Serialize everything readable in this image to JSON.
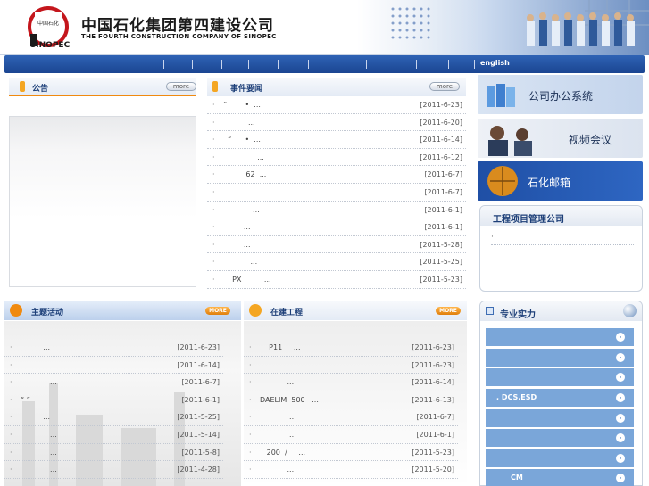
{
  "header": {
    "company_cn": "中国石化集团第四建设公司",
    "company_en": "THE FOURTH CONSTRUCTION COMPANY OF SINOPEC",
    "logo_text": "SINOPEC"
  },
  "nav": {
    "english_label": "english"
  },
  "announce": {
    "title": "公告",
    "more": "more"
  },
  "events": {
    "title": "事件要闻",
    "more": "more",
    "items": [
      {
        "text": "“        •  ...",
        "date": "[2011-6-23]"
      },
      {
        "text": "           ...",
        "date": "[2011-6-20]"
      },
      {
        "text": "  “      •  ...",
        "date": "[2011-6-14]"
      },
      {
        "text": "               ...",
        "date": "[2011-6-12]"
      },
      {
        "text": "          62  ...",
        "date": "[2011-6-7]"
      },
      {
        "text": "             ...",
        "date": "[2011-6-7]"
      },
      {
        "text": "             ...",
        "date": "[2011-6-1]"
      },
      {
        "text": "         ...",
        "date": "[2011-6-1]"
      },
      {
        "text": "         ...",
        "date": "[2011-5-28]"
      },
      {
        "text": "            ...",
        "date": "[2011-5-25]"
      },
      {
        "text": "    PX          ...",
        "date": "[2011-5-23]"
      }
    ]
  },
  "side": {
    "office": "公司办公系统",
    "video": "视频会议",
    "mail": "石化邮箱",
    "project_company_title": "工程项目管理公司",
    "project_company_item": "·",
    "strength_title": "专业实力",
    "strength_items": [
      "",
      "",
      "",
      ", DCS,ESD",
      "",
      "",
      "",
      "CM"
    ]
  },
  "topic": {
    "title": "主题活动",
    "more": "MORE",
    "items": [
      {
        "text": "          ...",
        "date": "[2011-6-23]"
      },
      {
        "text": "             ...",
        "date": "[2011-6-14]"
      },
      {
        "text": "             ...",
        "date": "[2011-6-7]"
      },
      {
        "text": "“ ” ",
        "date": "[2011-6-1]"
      },
      {
        "text": "          ...",
        "date": "[2011-5-25]"
      },
      {
        "text": "             ...",
        "date": "[2011-5-14]"
      },
      {
        "text": "             ...",
        "date": "[2011-5-8]"
      },
      {
        "text": "             ...",
        "date": "[2011-4-28]"
      }
    ]
  },
  "projects": {
    "title": "在建工程",
    "more": "MORE",
    "items": [
      {
        "text": "    P11     ...",
        "date": "[2011-6-23]"
      },
      {
        "text": "            ...",
        "date": "[2011-6-23]"
      },
      {
        "text": "            ...",
        "date": "[2011-6-14]"
      },
      {
        "text": "DAELIM  500   ...",
        "date": "[2011-6-13]"
      },
      {
        "text": "             ...",
        "date": "[2011-6-7]"
      },
      {
        "text": "             ...",
        "date": "[2011-6-1]"
      },
      {
        "text": "   200  /     ...",
        "date": "[2011-5-23]"
      },
      {
        "text": "            ...",
        "date": "[2011-5-20]"
      }
    ]
  },
  "colors": {
    "nav_blue": "#1b4591",
    "accent_orange": "#f08a10",
    "strength_blue": "#7aa6d9"
  }
}
